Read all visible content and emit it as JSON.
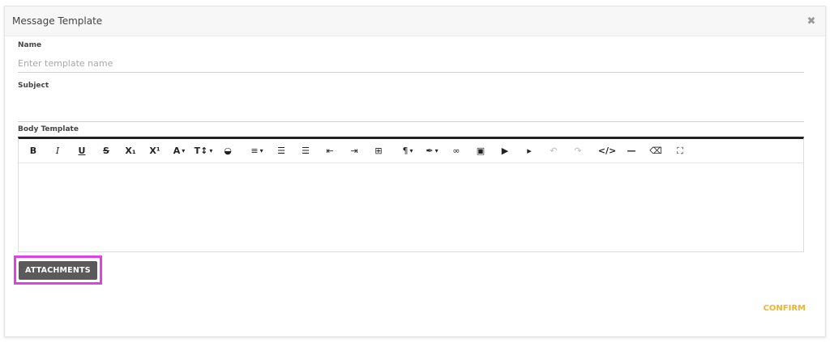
{
  "modal": {
    "title": "Message Template",
    "close_icon": "close-icon"
  },
  "form": {
    "name_label": "Name",
    "name_placeholder": "Enter template name",
    "name_value": "",
    "subject_label": "Subject",
    "subject_value": "",
    "body_label": "Body Template"
  },
  "toolbar": {
    "bold": "B",
    "italic": "I",
    "underline": "U",
    "strikethrough": "S",
    "subscript": "X₁",
    "superscript": "X¹",
    "font_color": "A",
    "font_size": "T↕",
    "ink": "◒",
    "align": "≡",
    "ordered_list": "☰",
    "unordered_list": "☰",
    "outdent": "⇤",
    "indent": "⇥",
    "table": "⊞",
    "paragraph": "¶",
    "style": "✒",
    "link": "∞",
    "image": "▣",
    "video": "▶",
    "cursor": "▸",
    "undo": "↶",
    "redo": "↷",
    "code": "</>",
    "hr": "—",
    "eraser": "⌫",
    "fullscreen": "⛶"
  },
  "actions": {
    "attachments_label": "ATTACHMENTS",
    "confirm_label": "CONFIRM"
  },
  "colors": {
    "accent": "#f0b42a",
    "highlight": "#e040e8",
    "button_bg": "#5a5a5a"
  }
}
